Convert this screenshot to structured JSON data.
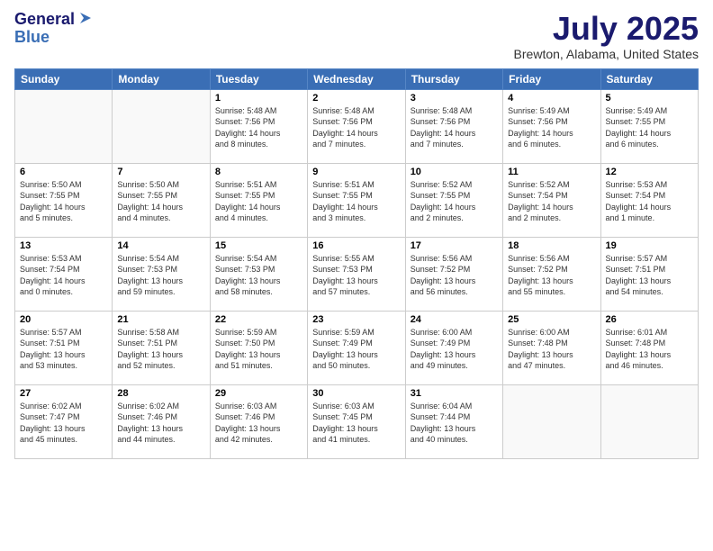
{
  "header": {
    "logo_line1": "General",
    "logo_line2": "Blue",
    "month_year": "July 2025",
    "location": "Brewton, Alabama, United States"
  },
  "weekdays": [
    "Sunday",
    "Monday",
    "Tuesday",
    "Wednesday",
    "Thursday",
    "Friday",
    "Saturday"
  ],
  "weeks": [
    [
      {
        "day": "",
        "info": ""
      },
      {
        "day": "",
        "info": ""
      },
      {
        "day": "1",
        "info": "Sunrise: 5:48 AM\nSunset: 7:56 PM\nDaylight: 14 hours\nand 8 minutes."
      },
      {
        "day": "2",
        "info": "Sunrise: 5:48 AM\nSunset: 7:56 PM\nDaylight: 14 hours\nand 7 minutes."
      },
      {
        "day": "3",
        "info": "Sunrise: 5:48 AM\nSunset: 7:56 PM\nDaylight: 14 hours\nand 7 minutes."
      },
      {
        "day": "4",
        "info": "Sunrise: 5:49 AM\nSunset: 7:56 PM\nDaylight: 14 hours\nand 6 minutes."
      },
      {
        "day": "5",
        "info": "Sunrise: 5:49 AM\nSunset: 7:55 PM\nDaylight: 14 hours\nand 6 minutes."
      }
    ],
    [
      {
        "day": "6",
        "info": "Sunrise: 5:50 AM\nSunset: 7:55 PM\nDaylight: 14 hours\nand 5 minutes."
      },
      {
        "day": "7",
        "info": "Sunrise: 5:50 AM\nSunset: 7:55 PM\nDaylight: 14 hours\nand 4 minutes."
      },
      {
        "day": "8",
        "info": "Sunrise: 5:51 AM\nSunset: 7:55 PM\nDaylight: 14 hours\nand 4 minutes."
      },
      {
        "day": "9",
        "info": "Sunrise: 5:51 AM\nSunset: 7:55 PM\nDaylight: 14 hours\nand 3 minutes."
      },
      {
        "day": "10",
        "info": "Sunrise: 5:52 AM\nSunset: 7:55 PM\nDaylight: 14 hours\nand 2 minutes."
      },
      {
        "day": "11",
        "info": "Sunrise: 5:52 AM\nSunset: 7:54 PM\nDaylight: 14 hours\nand 2 minutes."
      },
      {
        "day": "12",
        "info": "Sunrise: 5:53 AM\nSunset: 7:54 PM\nDaylight: 14 hours\nand 1 minute."
      }
    ],
    [
      {
        "day": "13",
        "info": "Sunrise: 5:53 AM\nSunset: 7:54 PM\nDaylight: 14 hours\nand 0 minutes."
      },
      {
        "day": "14",
        "info": "Sunrise: 5:54 AM\nSunset: 7:53 PM\nDaylight: 13 hours\nand 59 minutes."
      },
      {
        "day": "15",
        "info": "Sunrise: 5:54 AM\nSunset: 7:53 PM\nDaylight: 13 hours\nand 58 minutes."
      },
      {
        "day": "16",
        "info": "Sunrise: 5:55 AM\nSunset: 7:53 PM\nDaylight: 13 hours\nand 57 minutes."
      },
      {
        "day": "17",
        "info": "Sunrise: 5:56 AM\nSunset: 7:52 PM\nDaylight: 13 hours\nand 56 minutes."
      },
      {
        "day": "18",
        "info": "Sunrise: 5:56 AM\nSunset: 7:52 PM\nDaylight: 13 hours\nand 55 minutes."
      },
      {
        "day": "19",
        "info": "Sunrise: 5:57 AM\nSunset: 7:51 PM\nDaylight: 13 hours\nand 54 minutes."
      }
    ],
    [
      {
        "day": "20",
        "info": "Sunrise: 5:57 AM\nSunset: 7:51 PM\nDaylight: 13 hours\nand 53 minutes."
      },
      {
        "day": "21",
        "info": "Sunrise: 5:58 AM\nSunset: 7:51 PM\nDaylight: 13 hours\nand 52 minutes."
      },
      {
        "day": "22",
        "info": "Sunrise: 5:59 AM\nSunset: 7:50 PM\nDaylight: 13 hours\nand 51 minutes."
      },
      {
        "day": "23",
        "info": "Sunrise: 5:59 AM\nSunset: 7:49 PM\nDaylight: 13 hours\nand 50 minutes."
      },
      {
        "day": "24",
        "info": "Sunrise: 6:00 AM\nSunset: 7:49 PM\nDaylight: 13 hours\nand 49 minutes."
      },
      {
        "day": "25",
        "info": "Sunrise: 6:00 AM\nSunset: 7:48 PM\nDaylight: 13 hours\nand 47 minutes."
      },
      {
        "day": "26",
        "info": "Sunrise: 6:01 AM\nSunset: 7:48 PM\nDaylight: 13 hours\nand 46 minutes."
      }
    ],
    [
      {
        "day": "27",
        "info": "Sunrise: 6:02 AM\nSunset: 7:47 PM\nDaylight: 13 hours\nand 45 minutes."
      },
      {
        "day": "28",
        "info": "Sunrise: 6:02 AM\nSunset: 7:46 PM\nDaylight: 13 hours\nand 44 minutes."
      },
      {
        "day": "29",
        "info": "Sunrise: 6:03 AM\nSunset: 7:46 PM\nDaylight: 13 hours\nand 42 minutes."
      },
      {
        "day": "30",
        "info": "Sunrise: 6:03 AM\nSunset: 7:45 PM\nDaylight: 13 hours\nand 41 minutes."
      },
      {
        "day": "31",
        "info": "Sunrise: 6:04 AM\nSunset: 7:44 PM\nDaylight: 13 hours\nand 40 minutes."
      },
      {
        "day": "",
        "info": ""
      },
      {
        "day": "",
        "info": ""
      }
    ]
  ]
}
